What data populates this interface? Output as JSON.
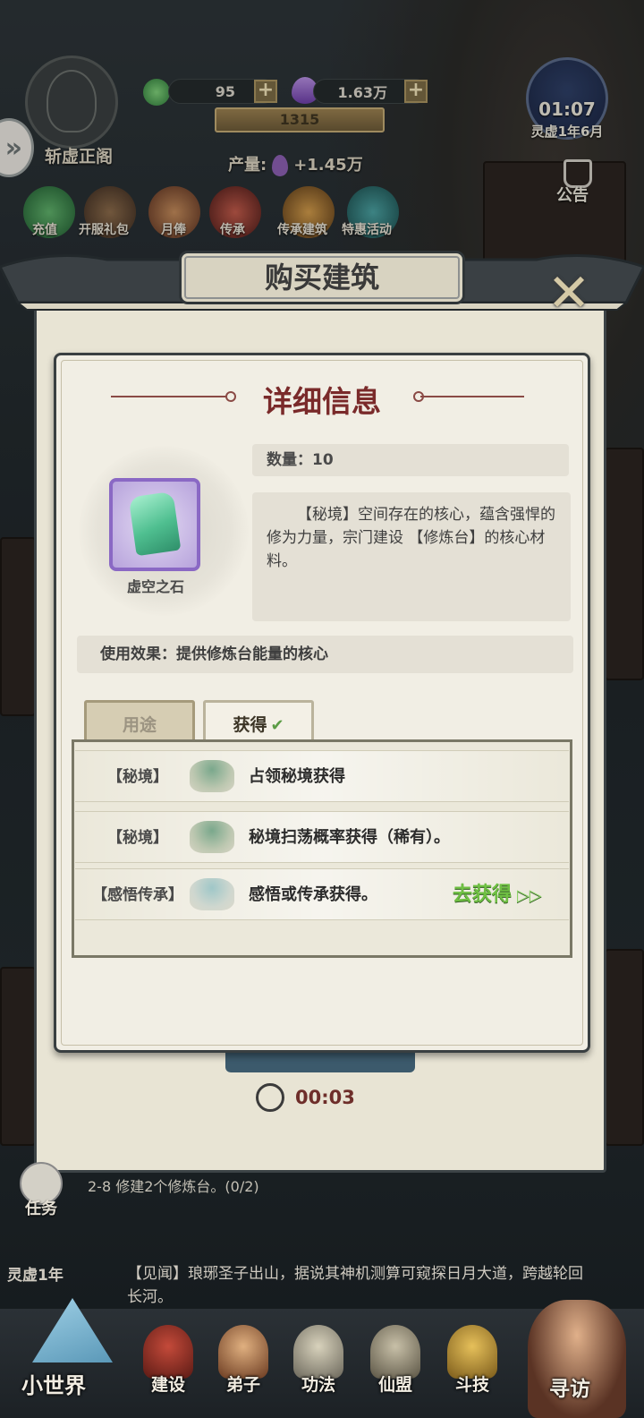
{
  "hud": {
    "sect_name": "斩虚正阁",
    "spirit_stone": "95",
    "crystal": "1.63万",
    "plus_sign": "+",
    "level": "1315",
    "production_label": "产量:",
    "production_value": "+1.45万",
    "clock": "01:07",
    "calendar": "灵虚1年6月",
    "notice": "公告",
    "activities": [
      "充值",
      "开服礼包",
      "月俸",
      "传承",
      "传承建筑",
      "特惠活动"
    ]
  },
  "modal": {
    "title": "购买建筑",
    "close_glyph": "✕",
    "timer": "00:03"
  },
  "detail": {
    "title": "详细信息",
    "item_name": "虚空之石",
    "quantity": "数量：10",
    "description": "【秘境】空间存在的核心，蕴含强悍的修为力量，宗门建设 【修炼台】的核心材料。",
    "effect": "使用效果：提供修炼台能量的核心",
    "tabs": {
      "use": "用途",
      "obtain": "获得",
      "check": "✔"
    },
    "sources": [
      {
        "tag": "【秘境】",
        "text": "占领秘境获得"
      },
      {
        "tag": "【秘境】",
        "text": "秘境扫荡概率获得（稀有）。"
      },
      {
        "tag": "【感悟传承】",
        "text": "感悟或传承获得。"
      }
    ],
    "goto": "去获得",
    "goto_arrows": "▷▷"
  },
  "bottom": {
    "task_label": "任务",
    "task_text": "2-8 修建2个修炼台。(0/2)",
    "year": "灵虚1年",
    "news": "【见闻】琅琊圣子出山，据说其神机测算可窥探日月大道，跨越轮回长河。",
    "nav": [
      "小世界",
      "建设",
      "弟子",
      "功法",
      "仙盟",
      "斗技",
      "寻访"
    ]
  }
}
